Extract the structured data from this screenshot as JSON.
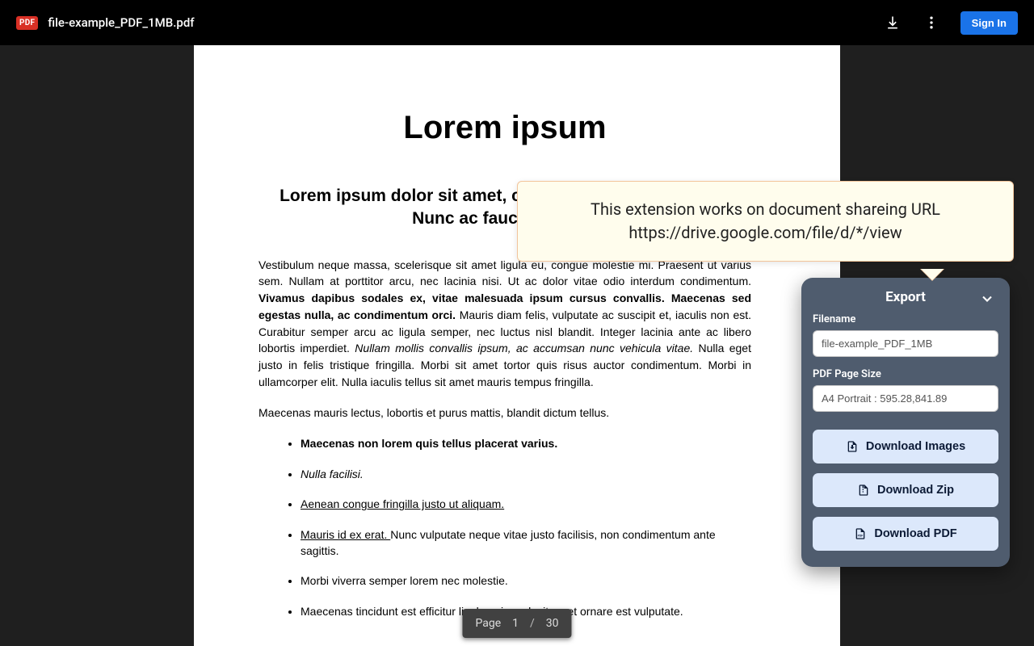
{
  "header": {
    "pdf_badge": "PDF",
    "filename": "file-example_PDF_1MB.pdf",
    "signin": "Sign In"
  },
  "page_indicator": {
    "label": "Page",
    "current": "1",
    "sep": "/",
    "total": "30"
  },
  "document": {
    "title": "Lorem ipsum",
    "subtitle": "Lorem ipsum dolor sit amet, consectetur adipiscing elit. Nunc ac faucibus odio.",
    "p1_a": "Vestibulum neque massa, scelerisque sit amet ligula eu, congue molestie mi. Praesent ut varius sem. Nullam at porttitor arcu, nec lacinia nisi. Ut ac dolor vitae odio interdum condimentum. ",
    "p1_b": "Vivamus dapibus sodales ex, vitae malesuada ipsum cursus convallis. Maecenas sed egestas nulla, ac condimentum orci.",
    "p1_c": " Mauris diam felis, vulputate ac suscipit et, iaculis non est. Curabitur semper arcu ac ligula semper, nec luctus nisl blandit. Integer lacinia ante ac libero lobortis imperdiet. ",
    "p1_d": "Nullam mollis convallis ipsum, ac accumsan nunc vehicula vitae.",
    "p1_e": " Nulla eget justo in felis tristique fringilla. Morbi sit amet tortor quis risus auctor condimentum. Morbi in ullamcorper elit. Nulla iaculis tellus sit amet mauris tempus fringilla.",
    "p2": "Maecenas mauris lectus, lobortis et purus mattis, blandit dictum tellus.",
    "li1": "Maecenas non lorem quis tellus placerat varius.",
    "li2": "Nulla facilisi.",
    "li3": "Aenean congue fringilla justo ut aliquam. ",
    "li4_a": "Mauris id ex erat. ",
    "li4_b": "Nunc vulputate neque vitae justo facilisis, non condimentum ante sagittis.",
    "li5": "Morbi viverra semper lorem nec molestie.",
    "li6": "Maecenas tincidunt est efficitur ligula euismod, sit amet ornare est vulputate."
  },
  "tooltip": {
    "line1": "This extension works on document shareing URL",
    "line2": "https://drive.google.com/file/d/*/view"
  },
  "export": {
    "title": "Export",
    "filename_label": "Filename",
    "filename_value": "file-example_PDF_1MB",
    "pagesize_label": "PDF Page Size",
    "pagesize_value": "A4 Portrait : 595.28,841.89",
    "btn_images": "Download Images",
    "btn_zip": "Download Zip",
    "btn_pdf": "Download PDF"
  }
}
